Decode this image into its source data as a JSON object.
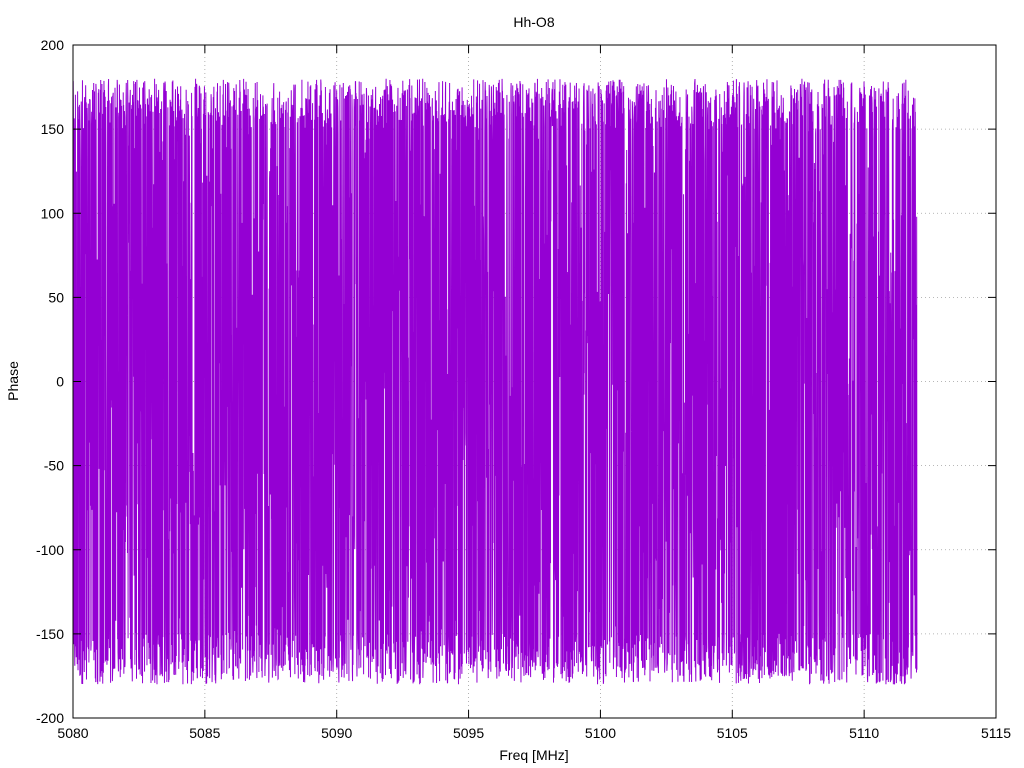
{
  "chart_data": {
    "type": "line",
    "title": "Hh-O8",
    "xlabel": "Freq [MHz]",
    "ylabel": "Phase",
    "xlim": [
      5080,
      5115
    ],
    "ylim": [
      -200,
      200
    ],
    "x_ticks": [
      5080,
      5085,
      5090,
      5095,
      5100,
      5105,
      5110,
      5115
    ],
    "y_ticks": [
      -200,
      -150,
      -100,
      -50,
      0,
      50,
      100,
      150,
      200
    ],
    "x_tick_labels": [
      "5080",
      "5085",
      "5090",
      "5095",
      "5100",
      "5105",
      "5110",
      "5115"
    ],
    "y_tick_labels": [
      "-200",
      "-150",
      "-100",
      "-50",
      "0",
      "50",
      "100",
      "150",
      "200"
    ],
    "grid": true,
    "legend": "none",
    "series": [
      {
        "color": "#9400d3",
        "x_range": [
          5080,
          5112
        ],
        "y_range": [
          -180,
          180
        ],
        "behavior": "phase wrapping rapidly between -180 and 180 (dense, noise-like)"
      }
    ]
  }
}
